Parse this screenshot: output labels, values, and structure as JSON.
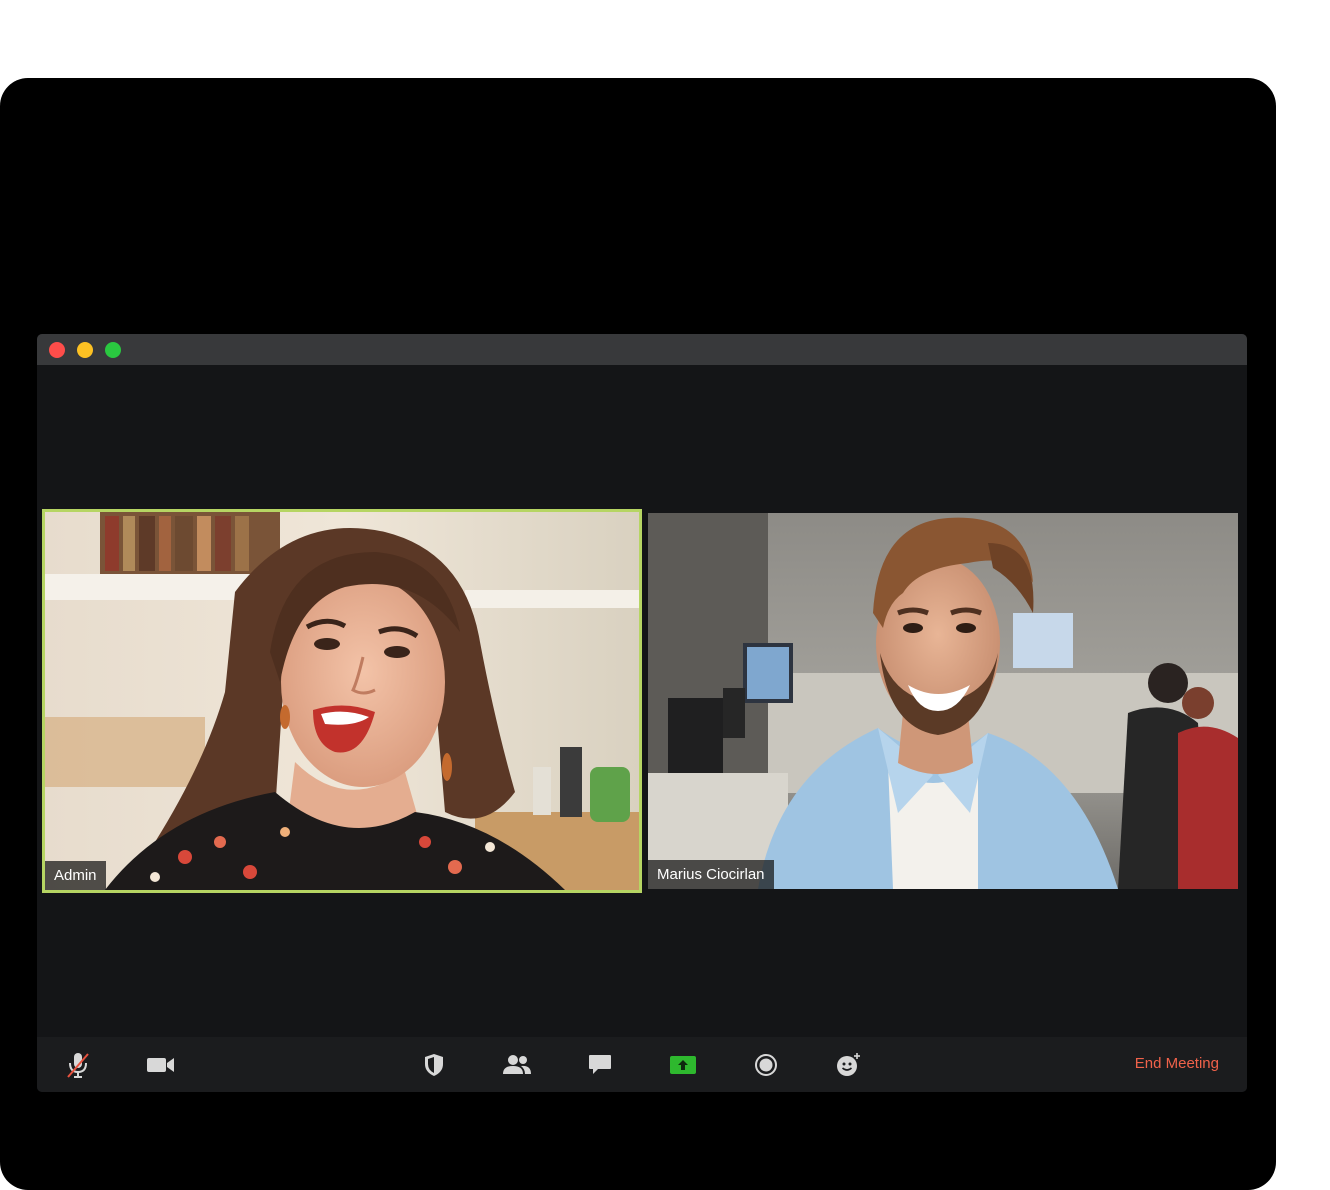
{
  "app": "Video Meeting",
  "participants": [
    {
      "name": "Admin",
      "active_speaker": true
    },
    {
      "name": "Marius Ciocirlan",
      "active_speaker": false
    }
  ],
  "toolbar": {
    "buttons": [
      {
        "icon": "microphone-muted-icon"
      },
      {
        "icon": "video-camera-icon"
      },
      {
        "icon": "shield-security-icon"
      },
      {
        "icon": "participants-icon"
      },
      {
        "icon": "chat-bubble-icon"
      },
      {
        "icon": "share-screen-icon"
      },
      {
        "icon": "record-icon"
      },
      {
        "icon": "reactions-icon"
      }
    ],
    "end_meeting_label": "End Meeting"
  },
  "colors": {
    "active_speaker_border": "#b6d563",
    "end_meeting": "#f0624a",
    "share_screen": "#2eb82e",
    "window_close": "#fe4d4a",
    "window_minimize": "#fdc123",
    "window_maximize": "#2ac840"
  }
}
